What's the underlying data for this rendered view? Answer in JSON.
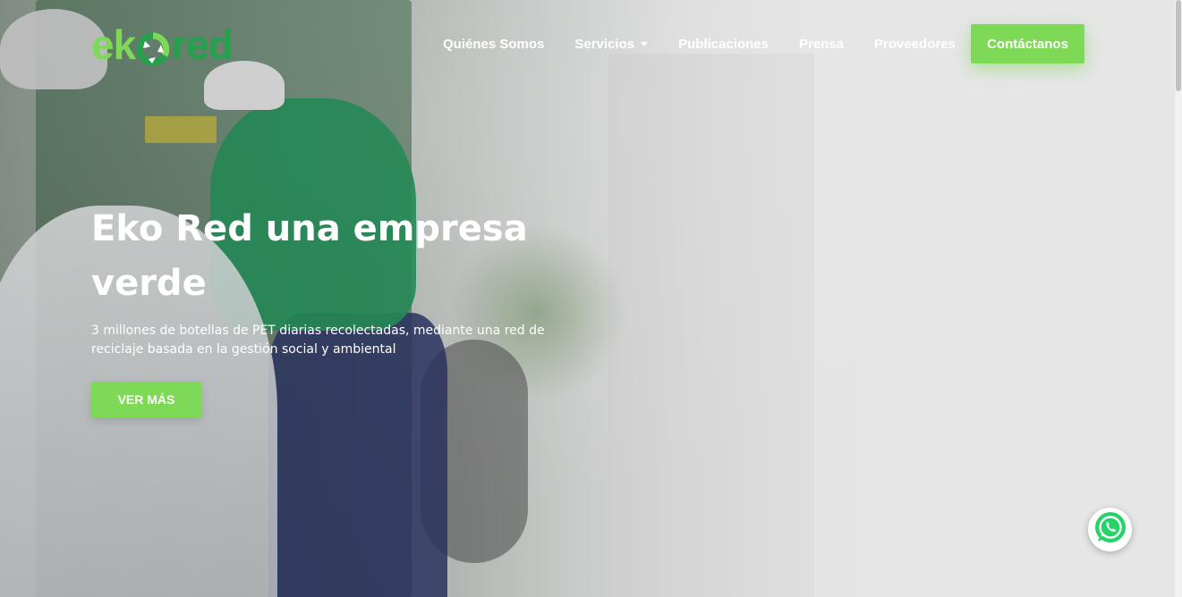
{
  "brand": {
    "logo_part1": "ek",
    "logo_part2": "red",
    "logo_mark_icon": "recycle-icon",
    "accent_color": "#7ed957",
    "dark_green": "#24a14b"
  },
  "nav": {
    "items": [
      {
        "label": "Quiénes Somos"
      },
      {
        "label": "Servicios",
        "has_dropdown": true
      },
      {
        "label": "Publicaciones"
      },
      {
        "label": "Prensa"
      },
      {
        "label": "Proveedores"
      }
    ],
    "contact_label": "Contáctanos"
  },
  "hero": {
    "title_line1": "Eko Red una empresa",
    "title_line2": "verde",
    "subtitle": "3 millones de botellas de PET diarias recolectadas, mediante una red de reciclaje basada en la gestión social y ambiental",
    "cta_label": "VER MÁS"
  },
  "floating": {
    "whatsapp_icon": "whatsapp-icon",
    "whatsapp_color": "#25d366"
  }
}
